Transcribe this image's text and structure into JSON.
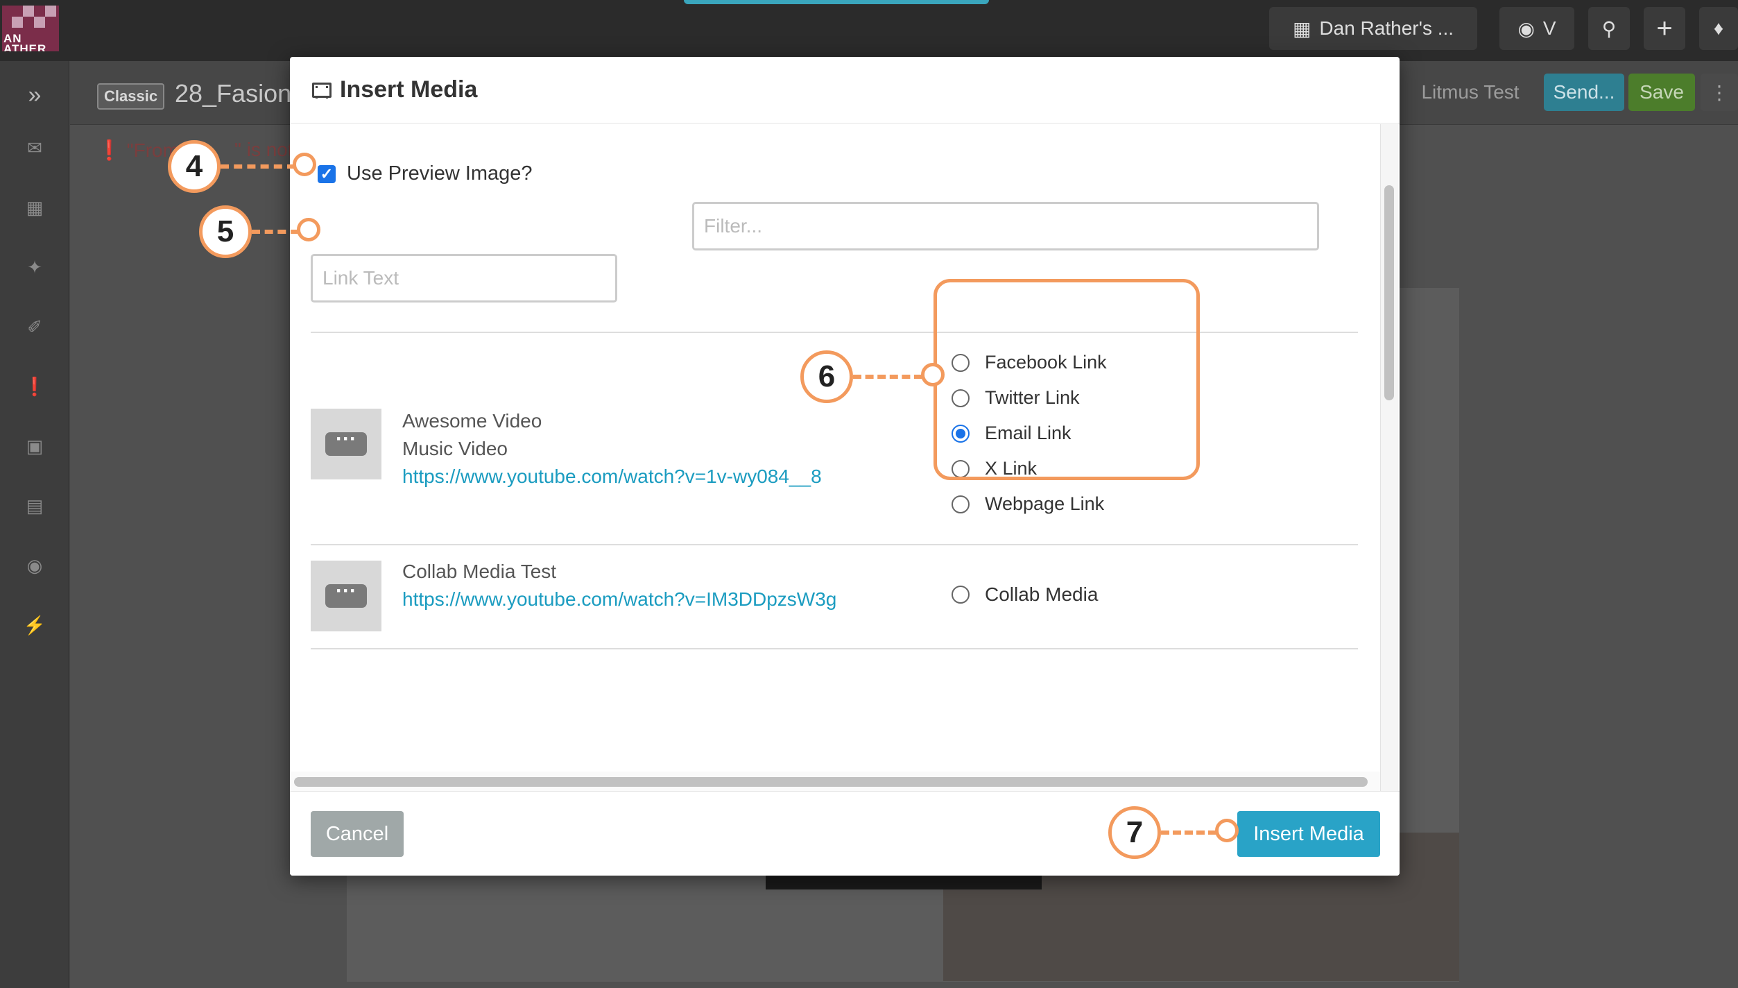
{
  "app": {
    "logo_text": "AN\nATHER",
    "org_name": "Dan Rather's ...",
    "user_initial": "V",
    "doc_badge": "Classic",
    "doc_title": "28_Fasion",
    "warning_start": "\"From",
    "warning_end": "\" is not v",
    "buttons": {
      "litmus": "Litmus Test",
      "send": "Send...",
      "save": "Save"
    }
  },
  "modal": {
    "title": "Insert Media",
    "title_icon": "film-icon",
    "use_preview_label": "Use Preview Image?",
    "use_preview_checked": true,
    "link_text_placeholder": "Link Text",
    "filter_placeholder": "Filter...",
    "media": [
      {
        "title": "Awesome Video",
        "subtitle": "Music Video",
        "url": "https://www.youtube.com/watch?v=1v-wy084__8",
        "options": [
          "Facebook Link",
          "Twitter Link",
          "Email Link",
          "X Link",
          "Webpage Link"
        ],
        "selected": "Email Link"
      },
      {
        "title": "Collab Media Test",
        "url": "https://www.youtube.com/watch?v=IM3DDpzsW3g",
        "options": [
          "Collab Media"
        ],
        "selected": null
      }
    ],
    "cancel_label": "Cancel",
    "insert_label": "Insert Media"
  },
  "callouts": [
    "4",
    "5",
    "6",
    "7"
  ],
  "colors": {
    "accent": "#29a3c7",
    "link": "#1b9cc0",
    "callout": "#f39a5d",
    "checkbox": "#1a73e8"
  }
}
